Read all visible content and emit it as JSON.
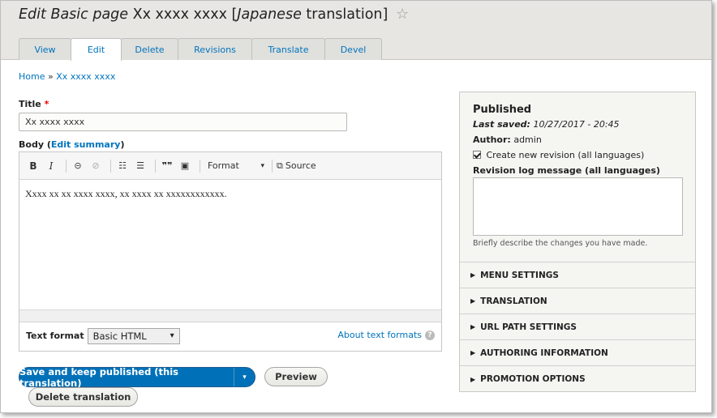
{
  "header": {
    "title_prefix": "Edit Basic page",
    "title_node": "Xx xxxx xxxx",
    "title_bracket_open": "[",
    "title_language": "Japanese",
    "title_suffix": "translation]",
    "star": "☆"
  },
  "tabs": [
    {
      "label": "View"
    },
    {
      "label": "Edit"
    },
    {
      "label": "Delete"
    },
    {
      "label": "Revisions"
    },
    {
      "label": "Translate"
    },
    {
      "label": "Devel"
    }
  ],
  "breadcrumb": {
    "home": "Home",
    "separator": "»",
    "current": "Xx xxxx xxxx"
  },
  "title_field": {
    "label": "Title",
    "required_mark": "*",
    "value": "Xx xxxx xxxx"
  },
  "body_field": {
    "label": "Body",
    "open_paren": "(",
    "summary_link": "Edit summary",
    "close_paren": ")"
  },
  "toolbar": {
    "bold": "B",
    "italic": "I",
    "link": "⊝",
    "unlink": "⊘",
    "bullet_list": "☷",
    "numbered_list": "☰",
    "blockquote": "❞❞",
    "image": "▣",
    "format_label": "Format",
    "format_arrow": "▾",
    "source_icon": "⧉",
    "source_label": "Source"
  },
  "editor": {
    "content": "Xxxx xx xx xxxx xxxx, xx xxxx xx xxxxxxxxxxxx."
  },
  "text_format": {
    "label": "Text format",
    "selected": "Basic HTML",
    "arrow": "▾",
    "about_link": "About text formats",
    "help_icon": "?"
  },
  "actions": {
    "save": "Save and keep published (this translation)",
    "save_arrow": "▾",
    "preview": "Preview",
    "delete": "Delete translation"
  },
  "sidebar": {
    "status": "Published",
    "last_saved_label": "Last saved:",
    "last_saved_value": "10/27/2017 - 20:45",
    "author_label": "Author:",
    "author_value": "admin",
    "new_revision_label": "Create new revision (all languages)",
    "revision_log_label": "Revision log message (all languages)",
    "revision_log_value": "",
    "revision_log_description": "Briefly describe the changes you have made.",
    "sections": [
      {
        "label": "MENU SETTINGS"
      },
      {
        "label": "TRANSLATION"
      },
      {
        "label": "URL PATH SETTINGS"
      },
      {
        "label": "AUTHORING INFORMATION"
      },
      {
        "label": "PROMOTION OPTIONS"
      }
    ],
    "section_marker": "▶"
  }
}
